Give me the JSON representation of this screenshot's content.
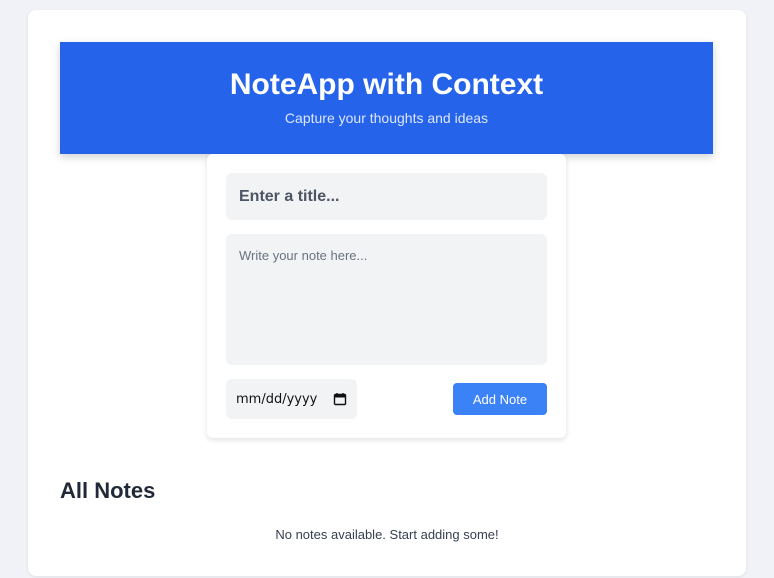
{
  "header": {
    "title": "NoteApp with Context",
    "subtitle": "Capture your thoughts and ideas"
  },
  "form": {
    "title_placeholder": "Enter a title...",
    "title_value": "",
    "note_placeholder": "Write your note here...",
    "note_value": "",
    "date_display": "mm/dd/yyyy",
    "date_icon": "calendar-icon",
    "add_button_label": "Add Note"
  },
  "notes": {
    "heading": "All Notes",
    "empty_message": "No notes available. Start adding some!"
  },
  "colors": {
    "header_bg": "#2563eb",
    "button_bg": "#3b82f6",
    "page_bg": "#f0f2f7",
    "input_bg": "#f2f3f5"
  }
}
